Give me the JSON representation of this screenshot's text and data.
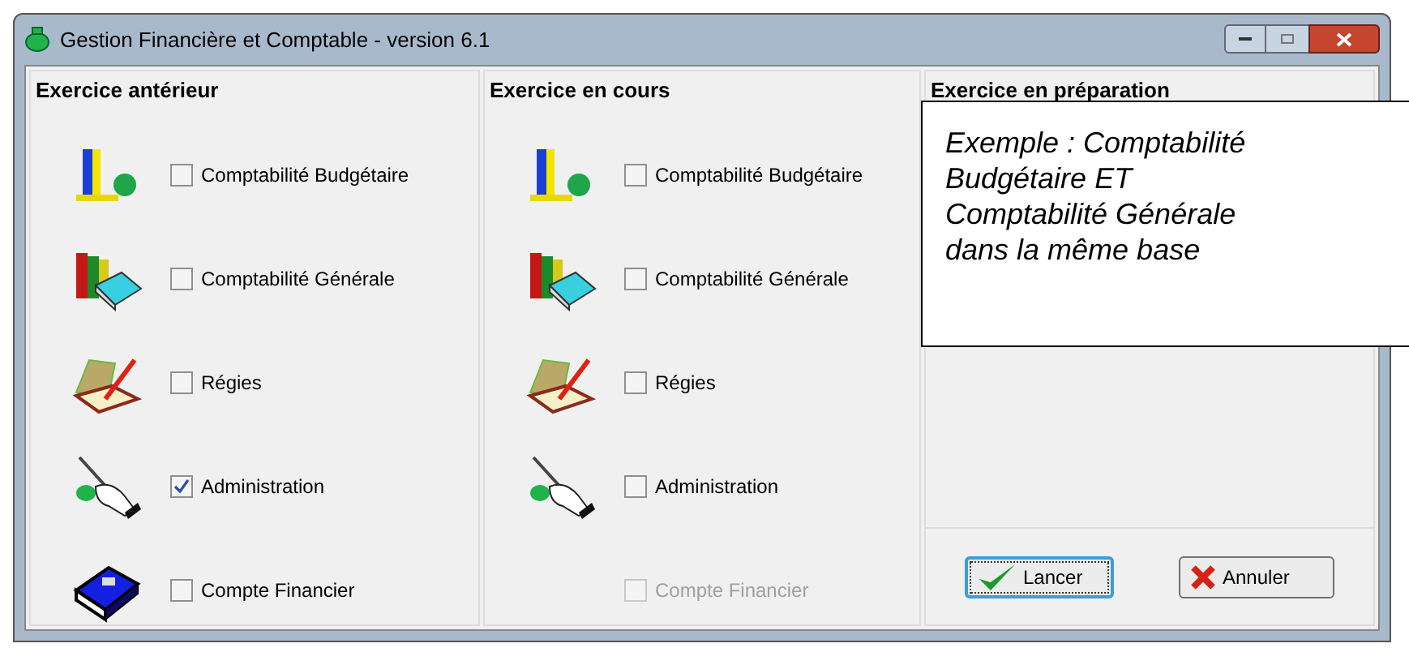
{
  "window": {
    "title": "Gestion Financière et Comptable - version 6.1"
  },
  "panels": [
    {
      "title": "Exercice antérieur",
      "items": [
        {
          "kind": "budget",
          "label": "Comptabilité Budgétaire",
          "checked": false,
          "disabled": false
        },
        {
          "kind": "general",
          "label": "Comptabilité Générale",
          "checked": false,
          "disabled": false
        },
        {
          "kind": "regies",
          "label": "Régies",
          "checked": false,
          "disabled": false
        },
        {
          "kind": "admin",
          "label": "Administration",
          "checked": true,
          "disabled": false
        },
        {
          "kind": "compte",
          "label": "Compte Financier",
          "checked": false,
          "disabled": false
        }
      ]
    },
    {
      "title": "Exercice en cours",
      "items": [
        {
          "kind": "budget",
          "label": "Comptabilité Budgétaire",
          "checked": false,
          "disabled": false
        },
        {
          "kind": "general",
          "label": "Comptabilité Générale",
          "checked": false,
          "disabled": false
        },
        {
          "kind": "regies",
          "label": "Régies",
          "checked": false,
          "disabled": false
        },
        {
          "kind": "admin",
          "label": "Administration",
          "checked": false,
          "disabled": false
        },
        {
          "label": "Compte Financier",
          "checked": false,
          "disabled": true
        }
      ]
    },
    {
      "title": "Exercice en préparation"
    }
  ],
  "callout": {
    "text": "Exemple : Comptabilité Budgétaire ET Comptabilité Générale dans la même base"
  },
  "buttons": [
    {
      "kind": "ok",
      "label": "Lancer",
      "focused": true
    },
    {
      "kind": "cancel",
      "label": "Annuler",
      "focused": false
    }
  ]
}
